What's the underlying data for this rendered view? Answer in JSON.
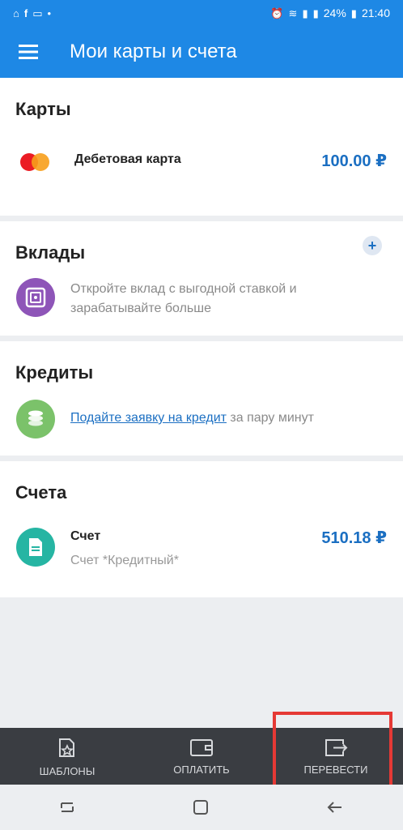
{
  "status_bar": {
    "battery": "24%",
    "time": "21:40"
  },
  "app_bar": {
    "title": "Мои карты и счета"
  },
  "sections": {
    "cards": {
      "title": "Карты",
      "item": {
        "name": "Дебетовая карта",
        "amount": "100.00 ₽"
      }
    },
    "deposits": {
      "title": "Вклады",
      "text": "Откройте вклад с выгодной ставкой и зарабатывайте больше",
      "add_label": "+"
    },
    "credits": {
      "title": "Кредиты",
      "link": "Подайте заявку на кредит",
      "suffix": " за пару минут"
    },
    "accounts": {
      "title": "Счета",
      "item": {
        "name": "Счет",
        "sub": "Счет *Кредитный*",
        "amount": "510.18 ₽"
      }
    }
  },
  "bottom_nav": {
    "items": [
      {
        "label": "ШАБЛОНЫ",
        "icon": "template-star-icon"
      },
      {
        "label": "ОПЛАТИТЬ",
        "icon": "wallet-icon"
      },
      {
        "label": "ПЕРЕВЕСТИ",
        "icon": "transfer-icon"
      }
    ]
  },
  "colors": {
    "primary": "#1e88e5",
    "accent": "#1b6fc2",
    "highlight": "#e53935",
    "nav_bg": "#3a3d42"
  }
}
